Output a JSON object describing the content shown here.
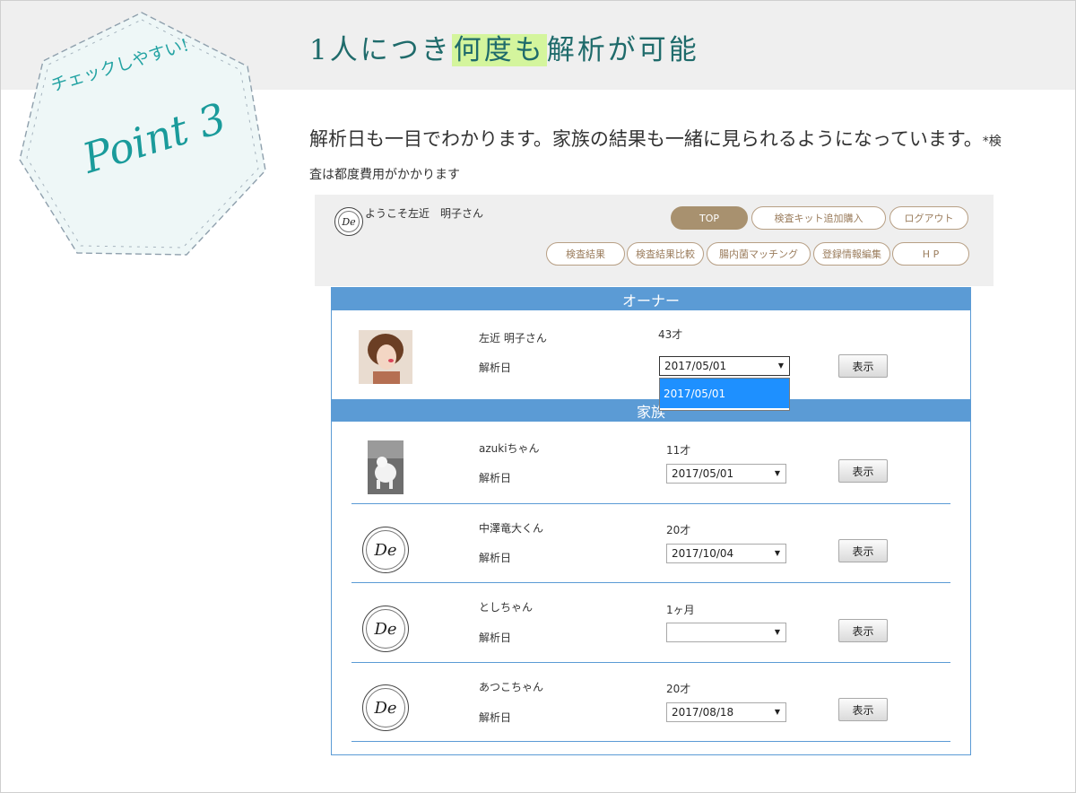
{
  "header": {
    "title_pre": "1人につき",
    "title_highlight": "何度も",
    "title_post": "解析が可能"
  },
  "badge": {
    "line1": "チェックしやすい!",
    "line2": "Point 3"
  },
  "description": {
    "main": "解析日も一目でわかります。家族の結果も一緒に見られるようになっています。",
    "note": "*検査は都度費用がかかります"
  },
  "app": {
    "logo_text": "De",
    "welcome": "ようこそ左近　明子さん",
    "nav_top": [
      "TOP",
      "検査キット追加購入",
      "ログアウト"
    ],
    "nav_bottom": [
      "検査結果",
      "検査結果比較",
      "腸内菌マッチング",
      "登録情報編集",
      "H P"
    ],
    "owner_header": "オーナー",
    "family_header": "家族",
    "analysis_label": "解析日",
    "show_label": "表示",
    "owner": {
      "name": "左近 明子さん",
      "age": "43才",
      "date": "2017/05/01",
      "dropdown_option": "2017/05/01"
    },
    "family": [
      {
        "name": "azukiちゃん",
        "age": "11才",
        "date": "2017/05/01"
      },
      {
        "name": "中澤竜大くん",
        "age": "20才",
        "date": "2017/10/04"
      },
      {
        "name": "としちゃん",
        "age": "1ヶ月",
        "date": ""
      },
      {
        "name": "あつこちゃん",
        "age": "20才",
        "date": "2017/08/18"
      }
    ]
  },
  "colors": {
    "accent_green": "#1f6b6b",
    "highlight": "#d4f59d",
    "panel_blue": "#5b9bd5",
    "nav_brown": "#a8916f",
    "select_blue": "#1e90ff"
  }
}
